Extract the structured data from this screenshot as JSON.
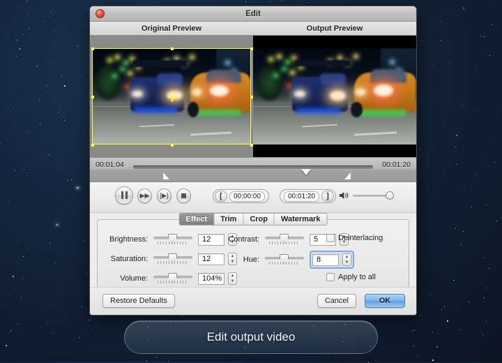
{
  "desktop": {
    "background_color": "#0d1b2e"
  },
  "window": {
    "title": "Edit",
    "close_icon": "close-button",
    "previews": {
      "original_label": "Original Preview",
      "output_label": "Output Preview",
      "crop_overlay_color": "#ffff30"
    },
    "timeline": {
      "current_time": "00:01:04",
      "total_time": "00:01:20",
      "playhead_percent": 72,
      "trim_start_percent": 15,
      "trim_end_percent": 88
    },
    "transport": {
      "pause_icon": "pause-icon",
      "forward_icon": "fast-forward-icon",
      "frame_step_icon": "frame-step-icon",
      "stop_icon": "stop-icon",
      "in_bracket": "[",
      "out_bracket": "]",
      "in_time": "00:00:00",
      "out_time": "00:01:20",
      "speaker_icon": "speaker-icon",
      "volume_percent": 100
    },
    "tabs": [
      {
        "label": "Effect",
        "active": true
      },
      {
        "label": "Trim",
        "active": false
      },
      {
        "label": "Crop",
        "active": false
      },
      {
        "label": "Watermark",
        "active": false
      }
    ],
    "effect": {
      "brightness_label": "Brightness:",
      "brightness_value": "12",
      "saturation_label": "Saturation:",
      "saturation_value": "12",
      "volume_label": "Volume:",
      "volume_value": "104%",
      "contrast_label": "Contrast:",
      "contrast_value": "5",
      "hue_label": "Hue:",
      "hue_value": "8",
      "deinterlacing_label": "Deinterlacing",
      "apply_to_all_label": "Apply to all",
      "focus_color": "#6aa0dc",
      "stepper_up": "▲",
      "stepper_down": "▼"
    },
    "footer": {
      "restore_label": "Restore Defaults",
      "cancel_label": "Cancel",
      "ok_label": "OK",
      "ok_accent_color": "#5ea0df"
    }
  },
  "banner": {
    "text": "Edit output video"
  }
}
